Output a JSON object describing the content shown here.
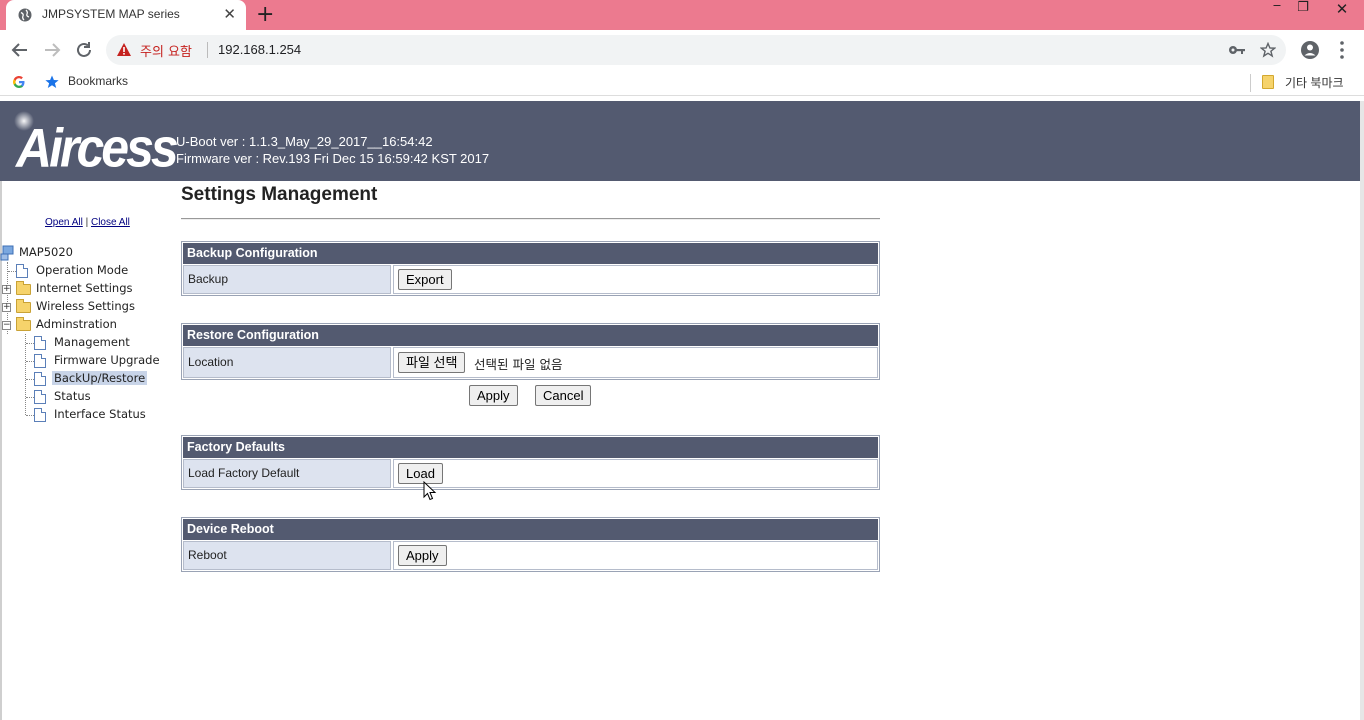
{
  "browser": {
    "tab_title": "JMPSYSTEM MAP series",
    "warning_text": "주의 요함",
    "url": "192.168.1.254",
    "bookmarks_label": "Bookmarks",
    "other_bookmarks_label": "기타 북마크"
  },
  "header": {
    "logo_text": "Aircess",
    "uboot_version": "U-Boot ver : 1.1.3_May_29_2017__16:54:42",
    "firmware_version": "Firmware ver : Rev.193 Fri Dec 15 16:59:42 KST 2017"
  },
  "tree": {
    "open_all": "Open All",
    "separator": "|",
    "close_all": "Close All",
    "root": "MAP5020",
    "items": {
      "operation_mode": "Operation Mode",
      "internet_settings": "Internet Settings",
      "wireless_settings": "Wireless Settings",
      "administration": "Adminstration",
      "management": "Management",
      "firmware_upgrade": "Firmware Upgrade",
      "backup_restore": "BackUp/Restore",
      "status": "Status",
      "interface_status": "Interface Status"
    },
    "selected": "BackUp/Restore"
  },
  "main": {
    "title": "Settings Management",
    "backup": {
      "heading": "Backup Configuration",
      "row_label": "Backup",
      "button": "Export"
    },
    "restore": {
      "heading": "Restore Configuration",
      "row_label": "Location",
      "file_button": "파일 선택",
      "file_status": "선택된 파일 없음",
      "apply_button": "Apply",
      "cancel_button": "Cancel"
    },
    "factory": {
      "heading": "Factory Defaults",
      "row_label": "Load Factory Default",
      "button": "Load"
    },
    "reboot": {
      "heading": "Device Reboot",
      "row_label": "Reboot",
      "button": "Apply"
    }
  },
  "colors": {
    "titlebar": "#ec7a8f",
    "banner": "#535a70",
    "section_header": "#535a70",
    "label_cell": "#dde3ef",
    "warning": "#c5221f"
  }
}
